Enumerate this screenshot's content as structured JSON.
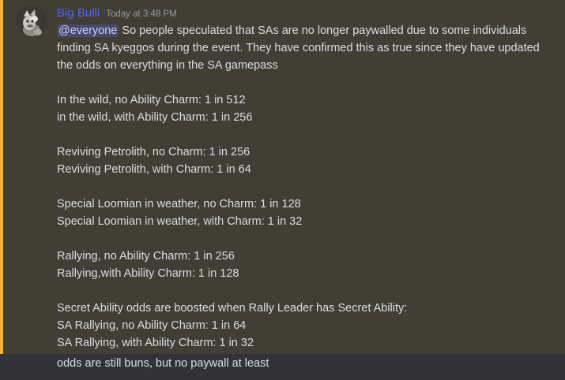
{
  "message": {
    "author": "Big Bulli",
    "timestamp": "Today at 3:48 PM",
    "mention": "@everyone",
    "intro_text": " So people speculated that SAs are no longer paywalled due to some individuals finding SA kyeggos during the event. They have confirmed this as true since they have updated the odds on everything in the SA gamepass",
    "odds_groups": [
      [
        "In the wild, no Ability Charm: 1 in 512",
        "in the wild, with Ability Charm: 1 in 256"
      ],
      [
        "Reviving Petrolith, no Charm: 1 in 256",
        "Reviving Petrolith, with Charm: 1 in 64"
      ],
      [
        "Special Loomian in weather, no Charm: 1 in 128",
        "Special Loomian in weather, with Charm: 1 in 32"
      ],
      [
        "Rallying, no Ability Charm: 1 in 256",
        "Rallying,with Ability Charm: 1 in 128"
      ],
      [
        "Secret Ability odds are boosted when Rally Leader has Secret Ability:",
        "SA Rallying, no Ability Charm: 1 in 64",
        "SA Rallying, with Ability Charm: 1 in 32"
      ]
    ]
  },
  "followup": {
    "text": "odds are still buns, but no paywall at least"
  },
  "colors": {
    "background": "#313338",
    "mention_highlight_bg": "#413e34",
    "mention_bar": "#f0b232",
    "username": "#5865f2",
    "text": "#dbdee1",
    "timestamp": "#949ba4"
  },
  "icons": {
    "avatar": "avatar-image"
  }
}
